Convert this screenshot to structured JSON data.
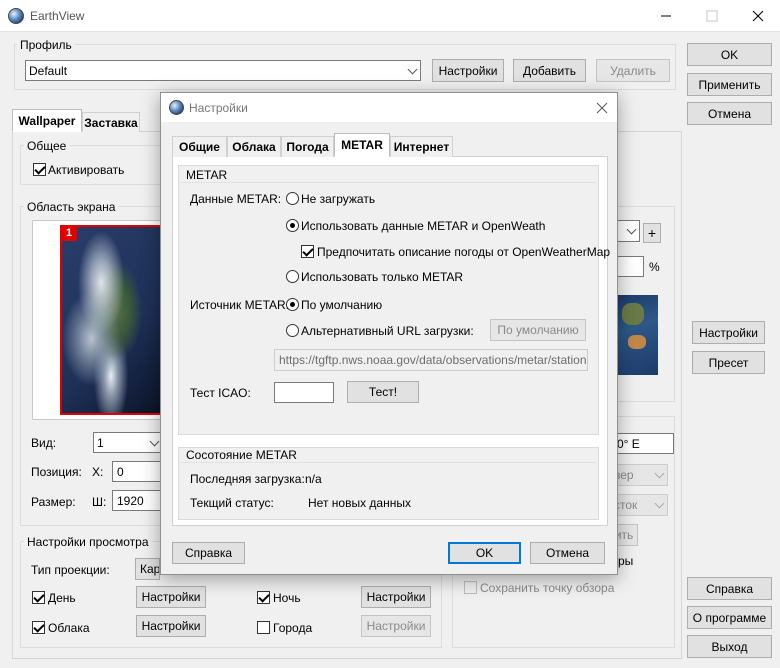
{
  "window": {
    "title": "EarthView"
  },
  "profile": {
    "group_title": "Профиль",
    "selected": "Default",
    "settings_button": "Настройки",
    "add_button": "Добавить",
    "delete_button": "Удалить"
  },
  "right_buttons": {
    "ok": "OK",
    "apply": "Применить",
    "cancel": "Отмена",
    "settings": "Настройки",
    "preset": "Пресет",
    "help": "Справка",
    "about": "О программе",
    "exit": "Выход"
  },
  "tabs": {
    "wallpaper": "Wallpaper",
    "screensaver": "Заставка"
  },
  "general": {
    "group_title": "Общее",
    "activate_label": "Активировать",
    "activate_checked": true
  },
  "screen_area": {
    "group_title": "Область экрана",
    "monitor_badge": "1",
    "view_label": "Вид:",
    "view_value": "1",
    "position_label": "Позиция:",
    "x_label": "X:",
    "x_value": "0",
    "size_label": "Размер:",
    "w_label": "Ш:",
    "w_value": "1920"
  },
  "preview_settings": {
    "group_title": "Настройки просмотра",
    "projection_label": "Тип проекции:",
    "projection_value": "Карт",
    "day_label": "День",
    "day_checked": true,
    "clouds_label": "Облака",
    "clouds_checked": true,
    "night_label": "Ночь",
    "night_checked": true,
    "cities_label": "Города",
    "cities_checked": false,
    "settings_label": "Настройки"
  },
  "bg_fragments": {
    "percent": "%",
    "plus": "+",
    "longitude": "0° E",
    "dd1": "вер",
    "dd2": "сток",
    "btn_frag": "ить",
    "text_frag": "ры",
    "save_viewpoint": "Сохранить точку обзора"
  },
  "dialog": {
    "title": "Настройки",
    "tabs": [
      "Общие",
      "Облака",
      "Погода",
      "METAR",
      "Интернет"
    ],
    "active_tab": "METAR",
    "metar_group": "METAR",
    "data_label": "Данные METAR:",
    "opt_no_load": "Не загружать",
    "opt_use_both": "Использовать данные METAR и OpenWeath",
    "opt_prefer": "Предпочитать описание погоды от OpenWeatherMap",
    "opt_only_metar": "Использовать только METAR",
    "source_label": "Источник METAR:",
    "src_default": "По умолчанию",
    "src_alt": "Альтернативный URL загрузки:",
    "src_default_button": "По умолчанию",
    "url_value": "https://tgftp.nws.noaa.gov/data/observations/metar/stations/",
    "icao_label": "Тест ICAO:",
    "icao_value": "",
    "test_button": "Тест!",
    "status_group": "Сосотояние METAR",
    "last_load_label": "Последняя загрузка:",
    "last_load_value": "n/a",
    "current_status_label": "Текщий статус:",
    "current_status_value": "Нет новых данных",
    "help_button": "Справка",
    "ok_button": "OK",
    "cancel_button": "Отмена"
  }
}
